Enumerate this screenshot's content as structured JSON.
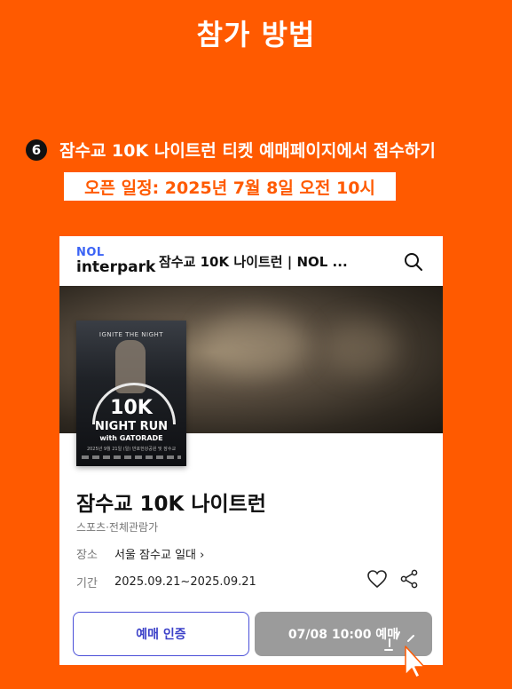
{
  "page": {
    "title": "참가 방법",
    "step_number": "6",
    "step_text": "잠수교 10K 나이트런 티켓 예매페이지에서 접수하기",
    "open_schedule": "오픈 일정: 2025년 7월 8일 오전 10시"
  },
  "app": {
    "logo_top": "NOL",
    "logo_bottom": "interpark",
    "header_title": "잠수교 10K 나이트런 | NOL ..."
  },
  "poster": {
    "tagline": "IGNITE THE NIGHT",
    "headline": "10K",
    "subhead": "NIGHT RUN",
    "sponsor": "with GATORADE",
    "info": "2025년 9월 21일 (일) 반포한강공원 및 잠수교"
  },
  "event": {
    "title": "잠수교 10K 나이트런",
    "category": "스포츠·전체관람가",
    "venue_label": "장소",
    "venue_value": "서울 잠수교 일대 ›",
    "period_label": "기간",
    "period_value": "2025.09.21~2025.09.21"
  },
  "buttons": {
    "cert_label": "예매 인증",
    "book_label": "07/08 10:00 예매"
  },
  "colors": {
    "background": "#ff5a00",
    "accent_blue": "#3b40c8",
    "disabled_button": "#9b9b9b"
  },
  "icons": [
    "search-icon",
    "heart-icon",
    "share-icon",
    "cursor-icon"
  ]
}
